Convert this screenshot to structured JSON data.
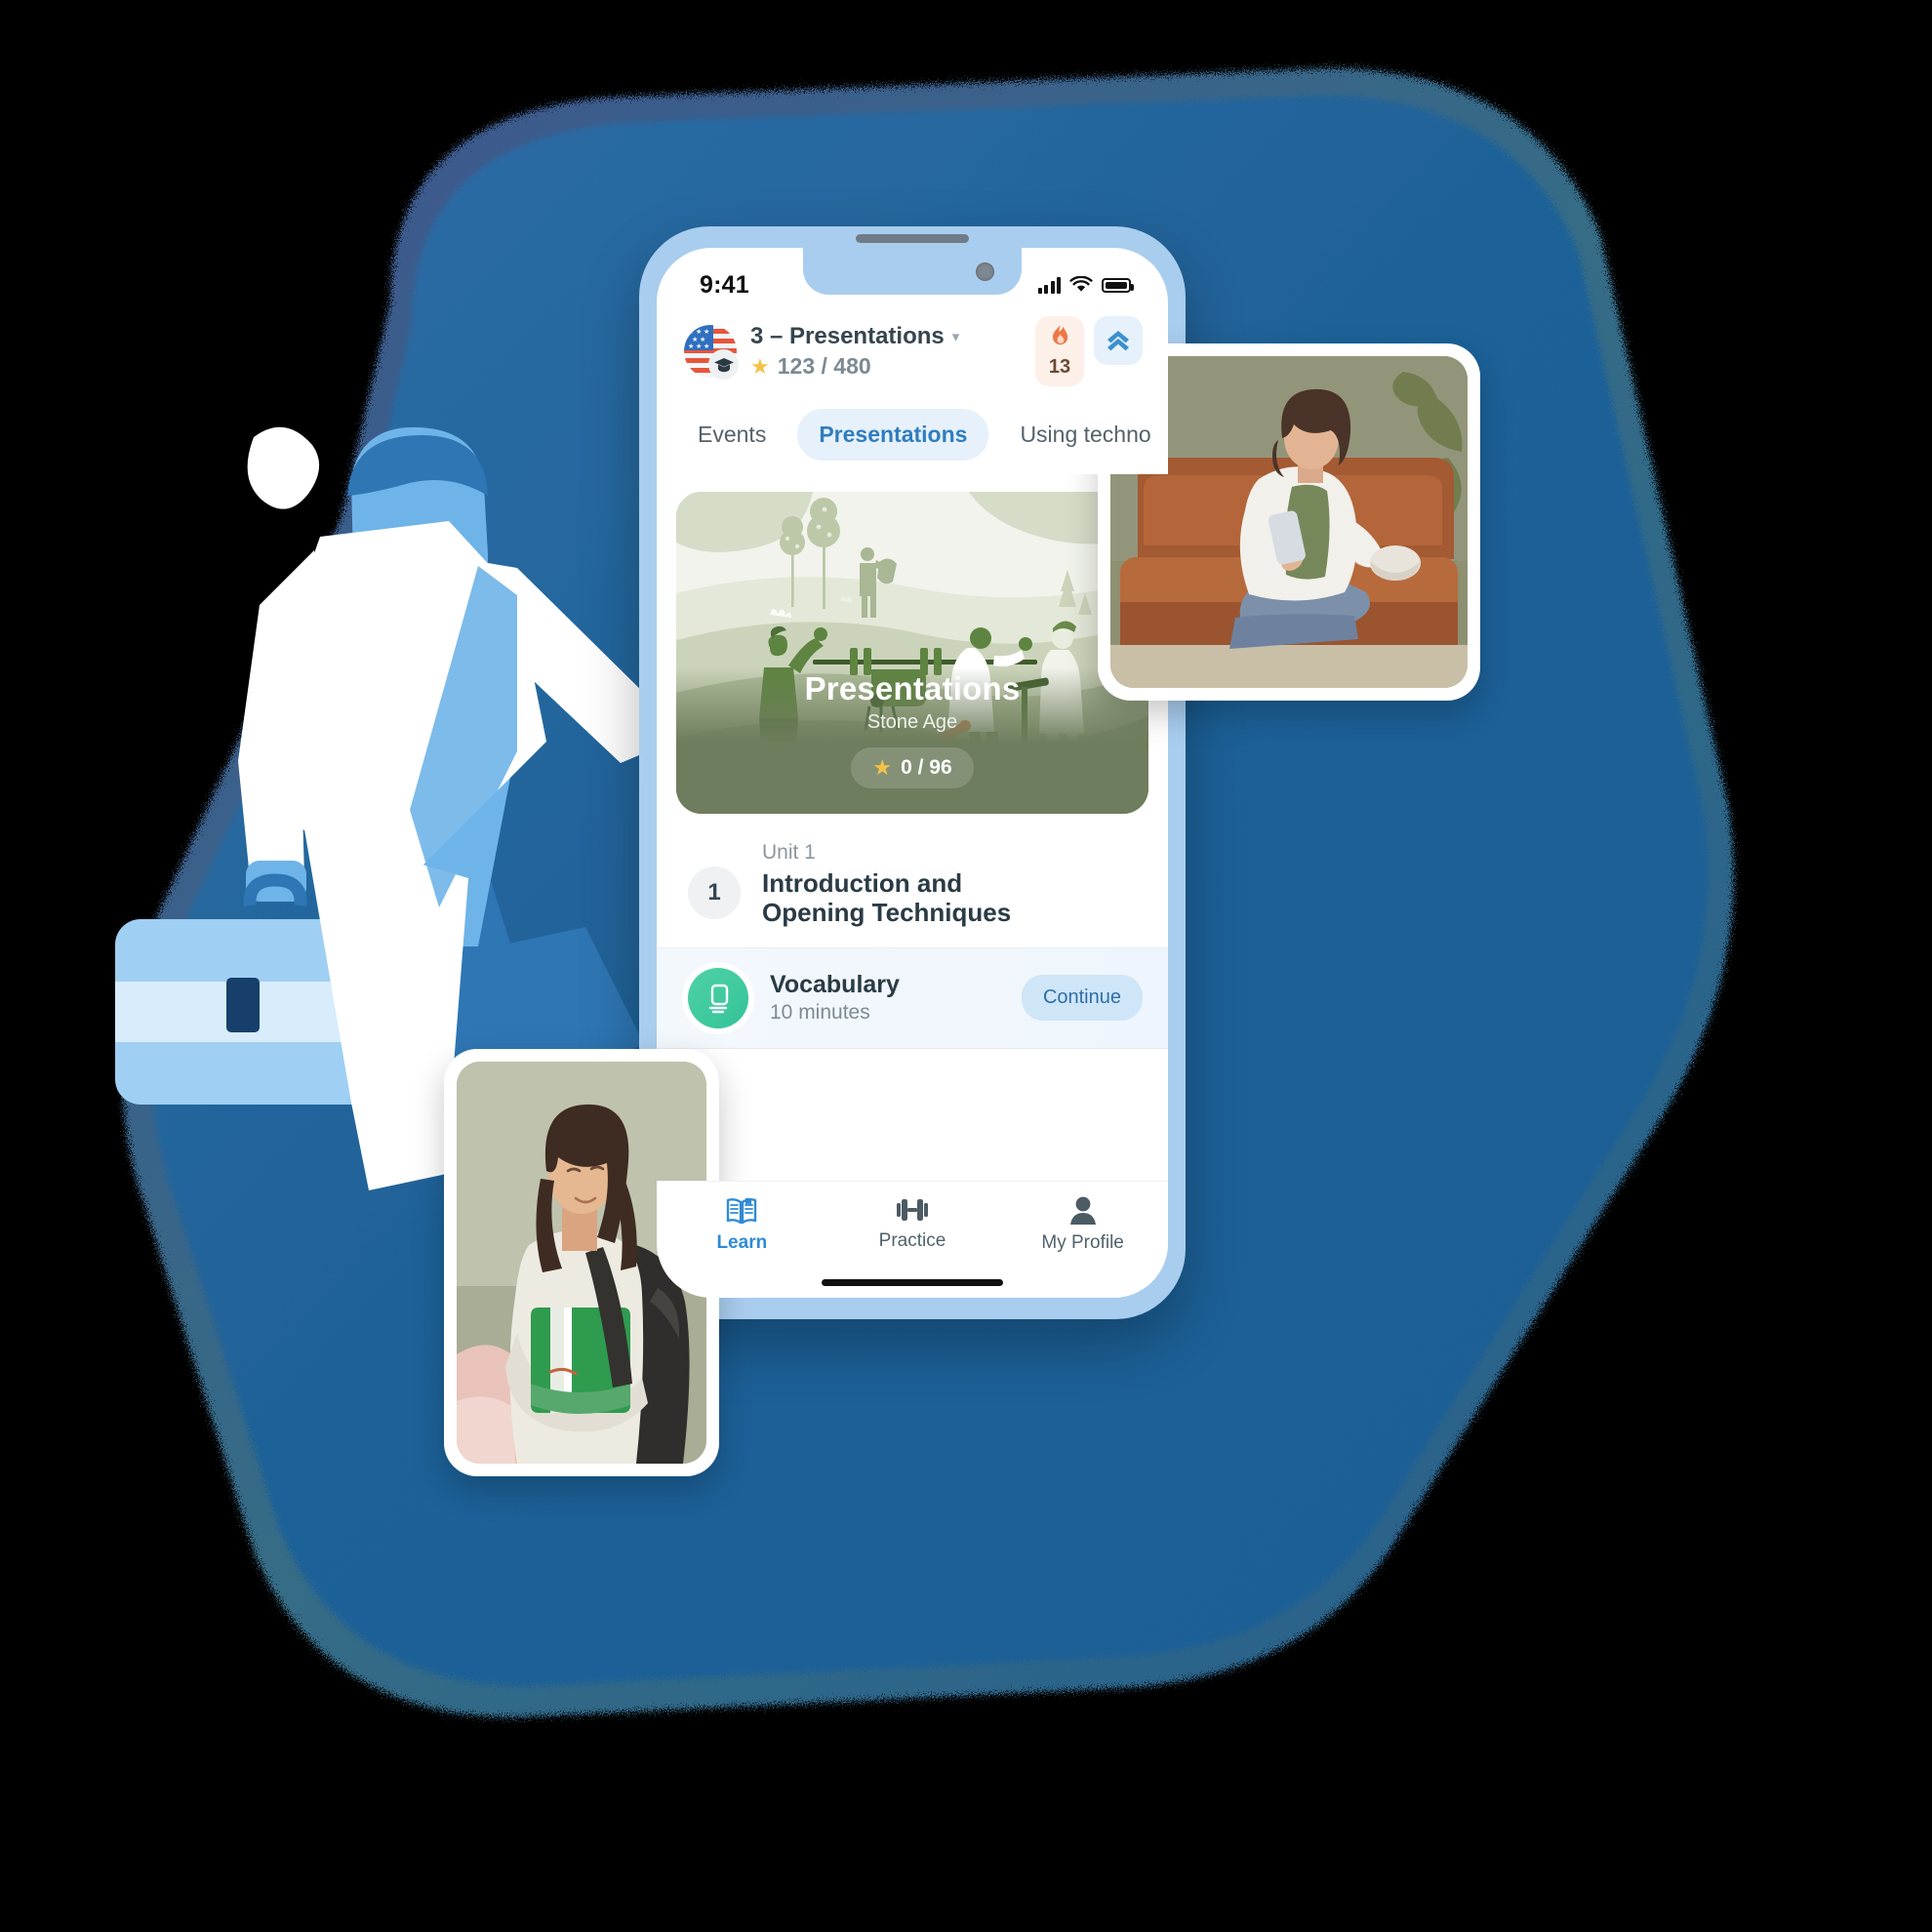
{
  "meta": {
    "app_kind": "language-learning-mobile-app",
    "accent_blue": "#2F8BD6",
    "chip_blue_bg": "#E6F1FB",
    "hero_green": "#6E7D5D",
    "streak_bg": "#FDF0E8",
    "star_yellow": "#F5C249",
    "lesson_teal": "#34C39A"
  },
  "status_bar": {
    "time": "9:41",
    "signal_icon": "cellular-bars-icon",
    "wifi_icon": "wifi-icon",
    "battery_icon": "battery-full-icon"
  },
  "header": {
    "course_flag_icon": "us-flag-icon",
    "course_badge_icon": "graduation-cap-icon",
    "title": "3 – Presentations",
    "dropdown_icon": "chevron-down-icon",
    "star_icon": "star-icon",
    "points": "123 / 480",
    "streak": {
      "icon": "flame-icon",
      "count": "13"
    },
    "level": {
      "icon": "double-chevron-up-icon"
    }
  },
  "tabs": [
    {
      "label": "Events",
      "active": false
    },
    {
      "label": "Presentations",
      "active": true
    },
    {
      "label": "Using techno",
      "active": false
    }
  ],
  "hero": {
    "title": "Presentations",
    "subtitle": "Stone Age",
    "star_icon": "star-icon",
    "progress": "0 / 96",
    "illustration": "stone-age-presentation-scene"
  },
  "unit": {
    "number": "1",
    "label": "Unit 1",
    "title": "Introduction and\nOpening Techniques"
  },
  "lesson": {
    "icon": "flashcard-icon",
    "title": "Vocabulary",
    "duration": "10 minutes",
    "action_label": "Continue"
  },
  "bottom_nav": [
    {
      "label": "Learn",
      "icon": "open-book-icon",
      "active": true
    },
    {
      "label": "Practice",
      "icon": "dumbbell-icon",
      "active": false
    },
    {
      "label": "My Profile",
      "icon": "person-icon",
      "active": false
    }
  ],
  "decorations": {
    "background_blob": "rounded-blue-blob",
    "person_illustration": "person-with-briefcase-illustration",
    "photo_top": "woman-on-leather-couch-with-phone-photo",
    "photo_bottom": "student-with-notebook-and-backpack-photo"
  }
}
